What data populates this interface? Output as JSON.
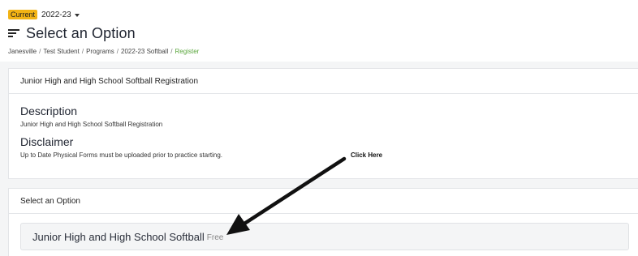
{
  "season": {
    "badge": "Current",
    "value": "2022-23"
  },
  "header": {
    "title": "Select an Option"
  },
  "breadcrumb": [
    {
      "label": "Janesville"
    },
    {
      "label": "Test Student"
    },
    {
      "label": "Programs"
    },
    {
      "label": "2022-23 Softball"
    },
    {
      "label": "Register"
    }
  ],
  "breadcrumb_separator": "/",
  "program_card": {
    "header": "Junior High and High School Softball Registration",
    "description_title": "Description",
    "description_text": "Junior High and High School Softball Registration",
    "disclaimer_title": "Disclaimer",
    "disclaimer_text": "Up to Date Physical Forms must be uploaded prior to practice starting."
  },
  "option_card": {
    "header": "Select an Option",
    "options": [
      {
        "name": "Junior High and High School Softball",
        "price": "Free"
      }
    ]
  },
  "annotation": {
    "label": "Click Here"
  },
  "colors": {
    "badge": "#f2b314",
    "active_crumb": "#5aa63c",
    "panel_bg": "#f4f5f6"
  }
}
